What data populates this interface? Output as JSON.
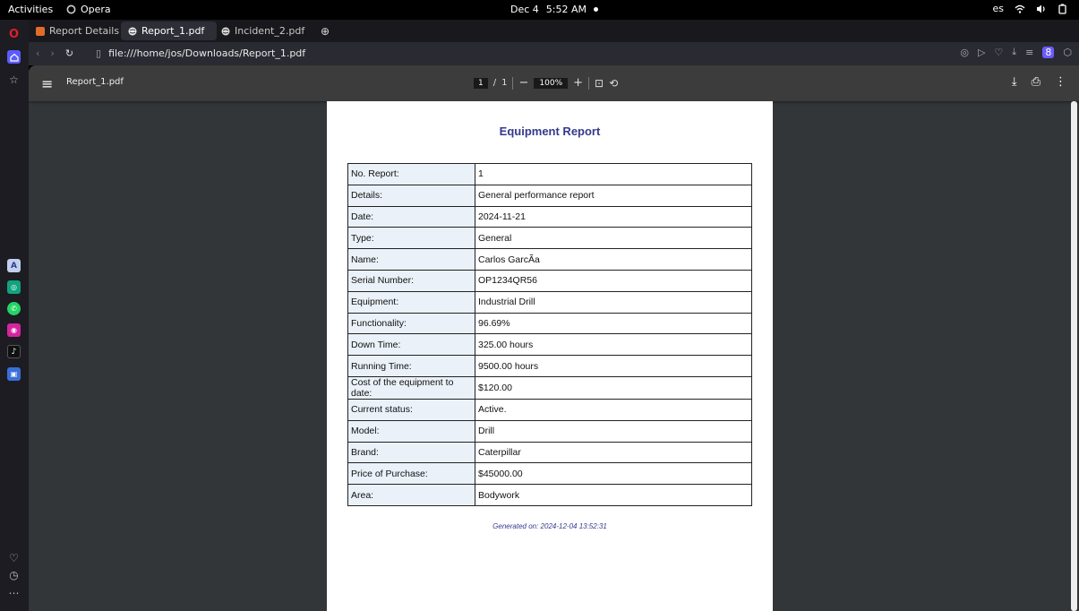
{
  "topbar": {
    "activities": "Activities",
    "app_name": "Opera",
    "date": "Dec 4",
    "time": "5:52 AM",
    "language": "es"
  },
  "tabs": [
    {
      "label": "Report Details",
      "icon": "opera-tab-icon",
      "icon_color": "#e06c2a"
    },
    {
      "label": "Report_1.pdf",
      "icon": "globe-icon"
    },
    {
      "label": "Incident_2.pdf",
      "icon": "globe-icon"
    }
  ],
  "address": {
    "url": "file:///home/jos/Downloads/Report_1.pdf"
  },
  "pdf_toolbar": {
    "file_name": "Report_1.pdf",
    "current_page": "1",
    "page_sep": "/",
    "total_pages": "1",
    "zoom": "100%"
  },
  "report": {
    "title": "Equipment Report",
    "rows": [
      {
        "label": "No. Report:",
        "value": "1"
      },
      {
        "label": "Details:",
        "value": "General performance report"
      },
      {
        "label": "Date:",
        "value": "2024-11-21"
      },
      {
        "label": "Type:",
        "value": "General"
      },
      {
        "label": "Name:",
        "value": "Carlos GarcÃ­a"
      },
      {
        "label": "Serial Number:",
        "value": "OP1234QR56"
      },
      {
        "label": "Equipment:",
        "value": "Industrial Drill"
      },
      {
        "label": "Functionality:",
        "value": "96.69%"
      },
      {
        "label": "Down Time:",
        "value": "325.00 hours"
      },
      {
        "label": "Running Time:",
        "value": "9500.00 hours"
      },
      {
        "label": "Cost of the equipment to date:",
        "value": "$120.00"
      },
      {
        "label": "Current status:",
        "value": "Active."
      },
      {
        "label": "Model:",
        "value": "Drill"
      },
      {
        "label": "Brand:",
        "value": "Caterpillar"
      },
      {
        "label": "Price of Purchase:",
        "value": "$45000.00"
      },
      {
        "label": "Area:",
        "value": "Bodywork"
      }
    ],
    "generated": "Generated on: 2024-12-04 13:52:31"
  },
  "colors": {
    "title": "#343a8d",
    "label_cell": "#eaf1f8",
    "viewer_bg": "#323639",
    "opera_red": "#e11d2a"
  }
}
